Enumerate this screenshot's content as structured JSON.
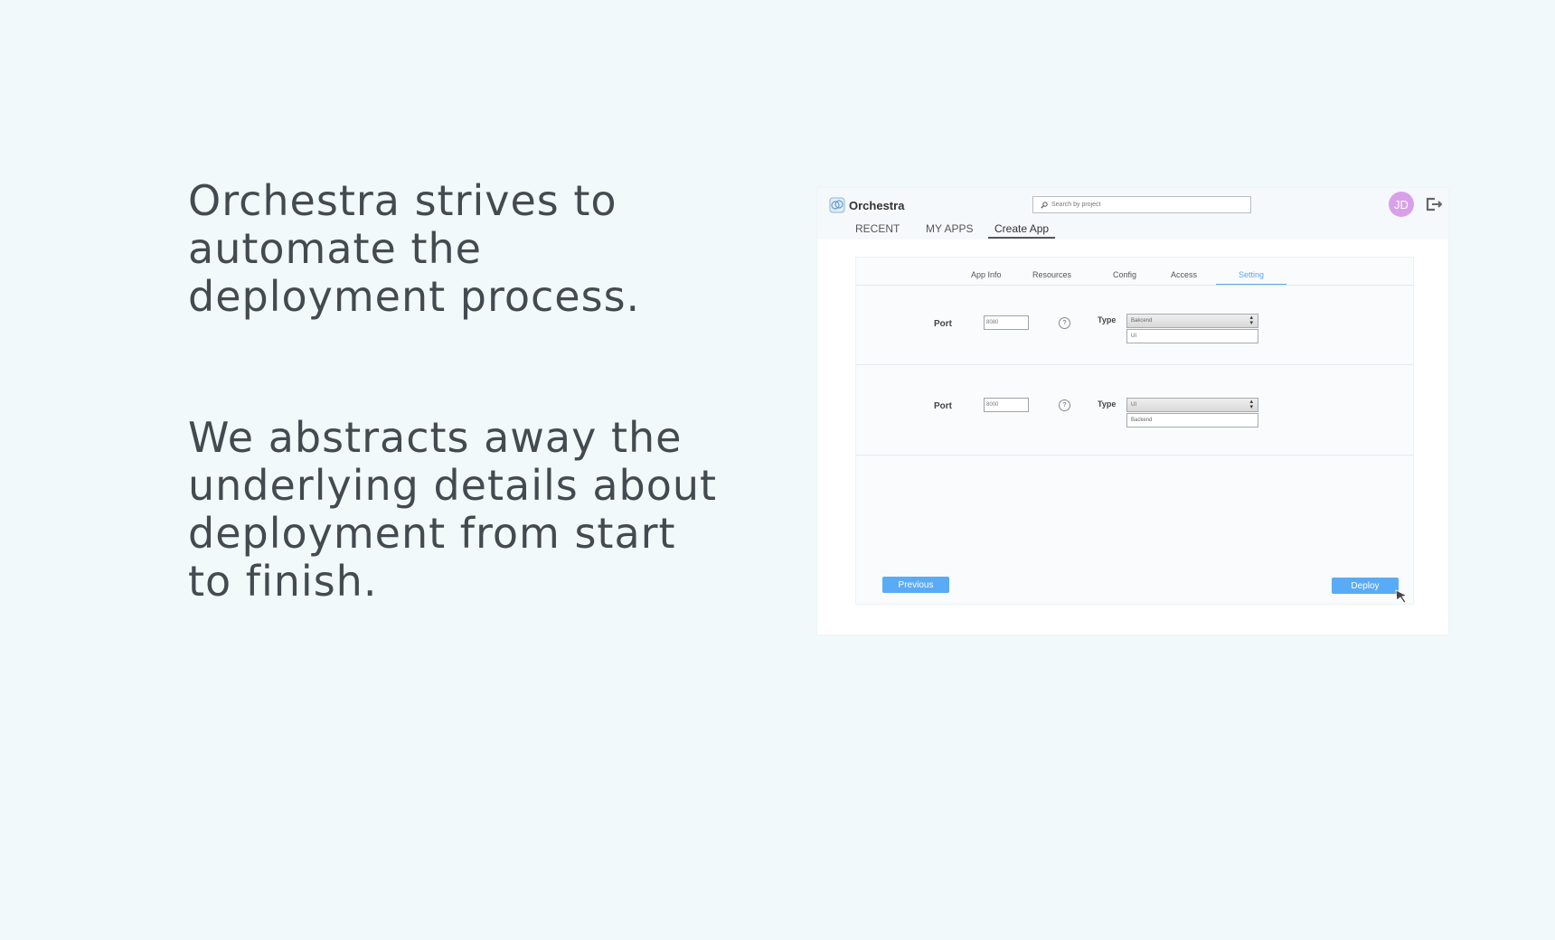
{
  "slide": {
    "paragraph_1": "Orchestra strives to automate the deployment process.",
    "paragraph_2": "We abstracts away the underlying details about deployment from start to finish."
  },
  "app": {
    "brand_name": "Orchestra",
    "search_placeholder": "Search by project",
    "avatar_initials": "JD",
    "avatar_color": "#d9a0ea",
    "nav": {
      "recent": "RECENT",
      "my_apps": "MY APPS",
      "create_app": "Create App"
    },
    "tabs": {
      "app_info": "App Info",
      "resources": "Resources",
      "config": "Config",
      "access": "Access",
      "setting": "Setting"
    },
    "accent_color": "#5aa7f2",
    "rows": [
      {
        "port_label": "Port",
        "port_value": "8080",
        "help": "?",
        "type_label": "Type",
        "type_selected": "Bakcend",
        "type_option": "UI"
      },
      {
        "port_label": "Port",
        "port_value": "8000",
        "help": "?",
        "type_label": "Type",
        "type_selected": "UI",
        "type_option": "Backend"
      }
    ],
    "buttons": {
      "previous": "Previous",
      "deploy": "Deploy"
    }
  }
}
